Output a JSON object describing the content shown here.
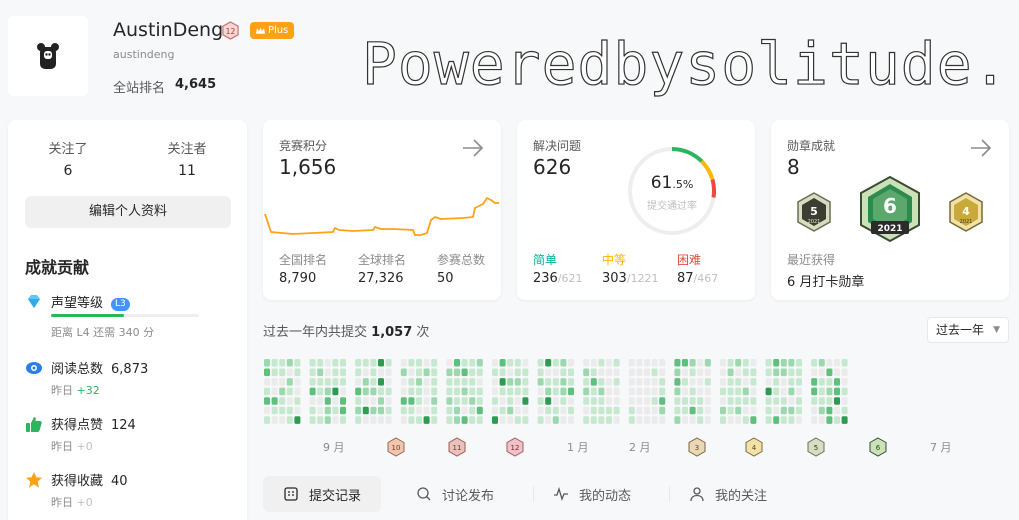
{
  "profile": {
    "name": "AustinDeng",
    "level": "12",
    "plus_label": "Plus",
    "handle": "austindeng",
    "site_rank_label": "全站排名",
    "site_rank": "4,645",
    "banner_text": "Poweredbysolitude."
  },
  "follow": {
    "following_label": "关注了",
    "following": "6",
    "followers_label": "关注者",
    "followers": "11"
  },
  "edit_profile_label": "编辑个人资料",
  "contributions": {
    "title": "成就贡献",
    "reputation": {
      "label": "声望等级",
      "pill": "L3",
      "sub": "距离 L4 还需 340 分",
      "progress": 0.49
    },
    "reads": {
      "label": "阅读总数",
      "value": "6,873",
      "sub_prefix": "昨日",
      "sub_delta": "+32"
    },
    "likes": {
      "label": "获得点赞",
      "value": "124",
      "sub_prefix": "昨日",
      "sub_delta": "+0"
    },
    "favorites": {
      "label": "获得收藏",
      "value": "40",
      "sub_prefix": "昨日",
      "sub_delta": "+0"
    }
  },
  "contest": {
    "title": "竞赛积分",
    "rating": "1,656",
    "global_rank_label": "全国排名",
    "global_rank": "8,790",
    "world_rank_label": "全球排名",
    "world_rank": "27,326",
    "attended_label": "参赛总数",
    "attended": "50"
  },
  "solved": {
    "title": "解决问题",
    "count": "626",
    "rate_int": "61",
    "rate_dec": ".5%",
    "rate_label": "提交通过率",
    "easy_label": "简单",
    "easy": "236",
    "easy_total": "/621",
    "medium_label": "中等",
    "medium": "303",
    "medium_total": "/1221",
    "hard_label": "困难",
    "hard": "87",
    "hard_total": "/467"
  },
  "badges": {
    "title": "勋章成就",
    "count": "8",
    "main_number": "6",
    "main_year": "2021",
    "left_number": "5",
    "left_year": "2021",
    "right_number": "4",
    "right_year": "2021",
    "recent_label": "最近获得",
    "recent": "6 月打卡勋章"
  },
  "submissions": {
    "prefix": "过去一年内共提交",
    "count": "1,057",
    "suffix": "次",
    "range_label": "过去一年"
  },
  "months": [
    "9 月",
    "1 月",
    "2 月",
    "7 月"
  ],
  "month_badges": [
    "10",
    "11",
    "12",
    "3",
    "4",
    "5",
    "6"
  ],
  "tabs": [
    "提交记录",
    "讨论发布",
    "我的动态",
    "我的关注"
  ],
  "colors": {
    "accent": "#ffa116",
    "green": "#2db55d",
    "easy": "#00af9b",
    "medium": "#ffb800",
    "hard": "#ef4743",
    "ring_track": "#eeeeee"
  }
}
